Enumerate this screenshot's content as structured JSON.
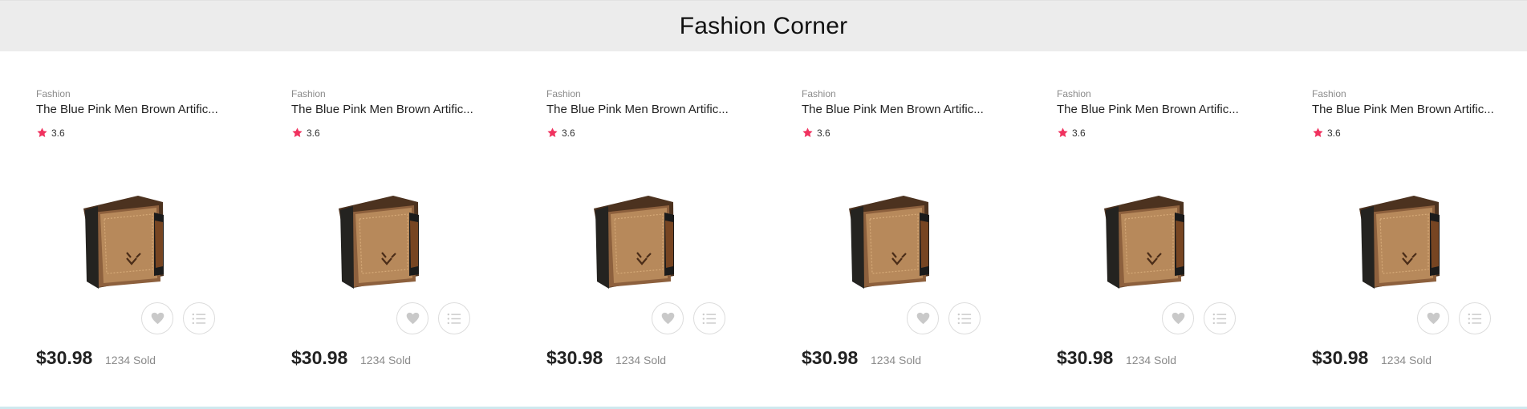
{
  "section": {
    "title": "Fashion Corner"
  },
  "products": [
    {
      "category": "Fashion",
      "title": "The Blue Pink Men Brown Artific...",
      "rating": "3.6",
      "price": "$30.98",
      "sold": "1234 Sold",
      "image_alt": "brown-wallet"
    },
    {
      "category": "Fashion",
      "title": "The Blue Pink Men Brown Artific...",
      "rating": "3.6",
      "price": "$30.98",
      "sold": "1234 Sold",
      "image_alt": "brown-wallet"
    },
    {
      "category": "Fashion",
      "title": "The Blue Pink Men Brown Artific...",
      "rating": "3.6",
      "price": "$30.98",
      "sold": "1234 Sold",
      "image_alt": "brown-wallet"
    },
    {
      "category": "Fashion",
      "title": "The Blue Pink Men Brown Artific...",
      "rating": "3.6",
      "price": "$30.98",
      "sold": "1234 Sold",
      "image_alt": "brown-wallet"
    },
    {
      "category": "Fashion",
      "title": "The Blue Pink Men Brown Artific...",
      "rating": "3.6",
      "price": "$30.98",
      "sold": "1234 Sold",
      "image_alt": "brown-wallet"
    },
    {
      "category": "Fashion",
      "title": "The Blue Pink Men Brown Artific...",
      "rating": "3.6",
      "price": "$30.98",
      "sold": "1234 Sold",
      "image_alt": "brown-wallet"
    }
  ],
  "icons": {
    "rating": "star-icon",
    "wishlist": "heart-icon",
    "compare": "list-icon"
  },
  "colors": {
    "header_background": "#ececec",
    "star": "#f0325f",
    "action_icon": "#c9c9c9"
  }
}
